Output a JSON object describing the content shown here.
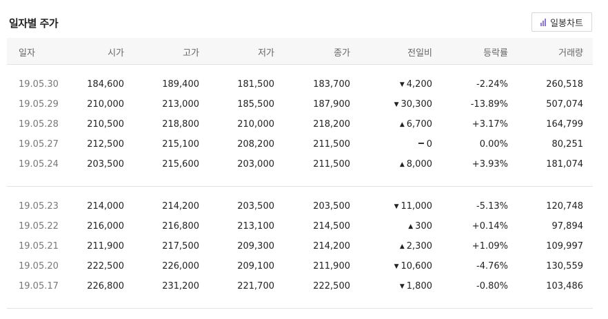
{
  "title": "일자별 주가",
  "chart_button_label": "일봉차트",
  "headers": [
    "일자",
    "시가",
    "고가",
    "저가",
    "종가",
    "전일비",
    "등락률",
    "거래량"
  ],
  "groups": [
    [
      {
        "date": "19.05.30",
        "open": "184,600",
        "high": "189,400",
        "low": "181,500",
        "close": "183,700",
        "dir": "down",
        "change": "4,200",
        "rate": "-2.24%",
        "volume": "260,518"
      },
      {
        "date": "19.05.29",
        "open": "210,000",
        "high": "213,000",
        "low": "185,500",
        "close": "187,900",
        "dir": "down",
        "change": "30,300",
        "rate": "-13.89%",
        "volume": "507,074"
      },
      {
        "date": "19.05.28",
        "open": "210,500",
        "high": "218,800",
        "low": "210,000",
        "close": "218,200",
        "dir": "up",
        "change": "6,700",
        "rate": "+3.17%",
        "volume": "164,799"
      },
      {
        "date": "19.05.27",
        "open": "212,500",
        "high": "215,100",
        "low": "208,200",
        "close": "211,500",
        "dir": "flat",
        "change": "0",
        "rate": "0.00%",
        "volume": "80,251"
      },
      {
        "date": "19.05.24",
        "open": "203,500",
        "high": "215,600",
        "low": "203,000",
        "close": "211,500",
        "dir": "up",
        "change": "8,000",
        "rate": "+3.93%",
        "volume": "181,074"
      }
    ],
    [
      {
        "date": "19.05.23",
        "open": "214,000",
        "high": "214,200",
        "low": "203,500",
        "close": "203,500",
        "dir": "down",
        "change": "11,000",
        "rate": "-5.13%",
        "volume": "120,748"
      },
      {
        "date": "19.05.22",
        "open": "216,000",
        "high": "216,800",
        "low": "213,100",
        "close": "214,500",
        "dir": "up",
        "change": "300",
        "rate": "+0.14%",
        "volume": "97,894"
      },
      {
        "date": "19.05.21",
        "open": "211,900",
        "high": "217,500",
        "low": "209,300",
        "close": "214,200",
        "dir": "up",
        "change": "2,300",
        "rate": "+1.09%",
        "volume": "109,997"
      },
      {
        "date": "19.05.20",
        "open": "222,500",
        "high": "226,000",
        "low": "209,100",
        "close": "211,900",
        "dir": "down",
        "change": "10,600",
        "rate": "-4.76%",
        "volume": "130,559"
      },
      {
        "date": "19.05.17",
        "open": "226,800",
        "high": "231,200",
        "low": "221,700",
        "close": "222,500",
        "dir": "down",
        "change": "1,800",
        "rate": "-0.80%",
        "volume": "103,486"
      }
    ]
  ],
  "colors": {
    "up": "#e0212b",
    "down": "#1a5fc7",
    "header_bg": "#f7f7f7",
    "accent": "#8b74d6"
  }
}
